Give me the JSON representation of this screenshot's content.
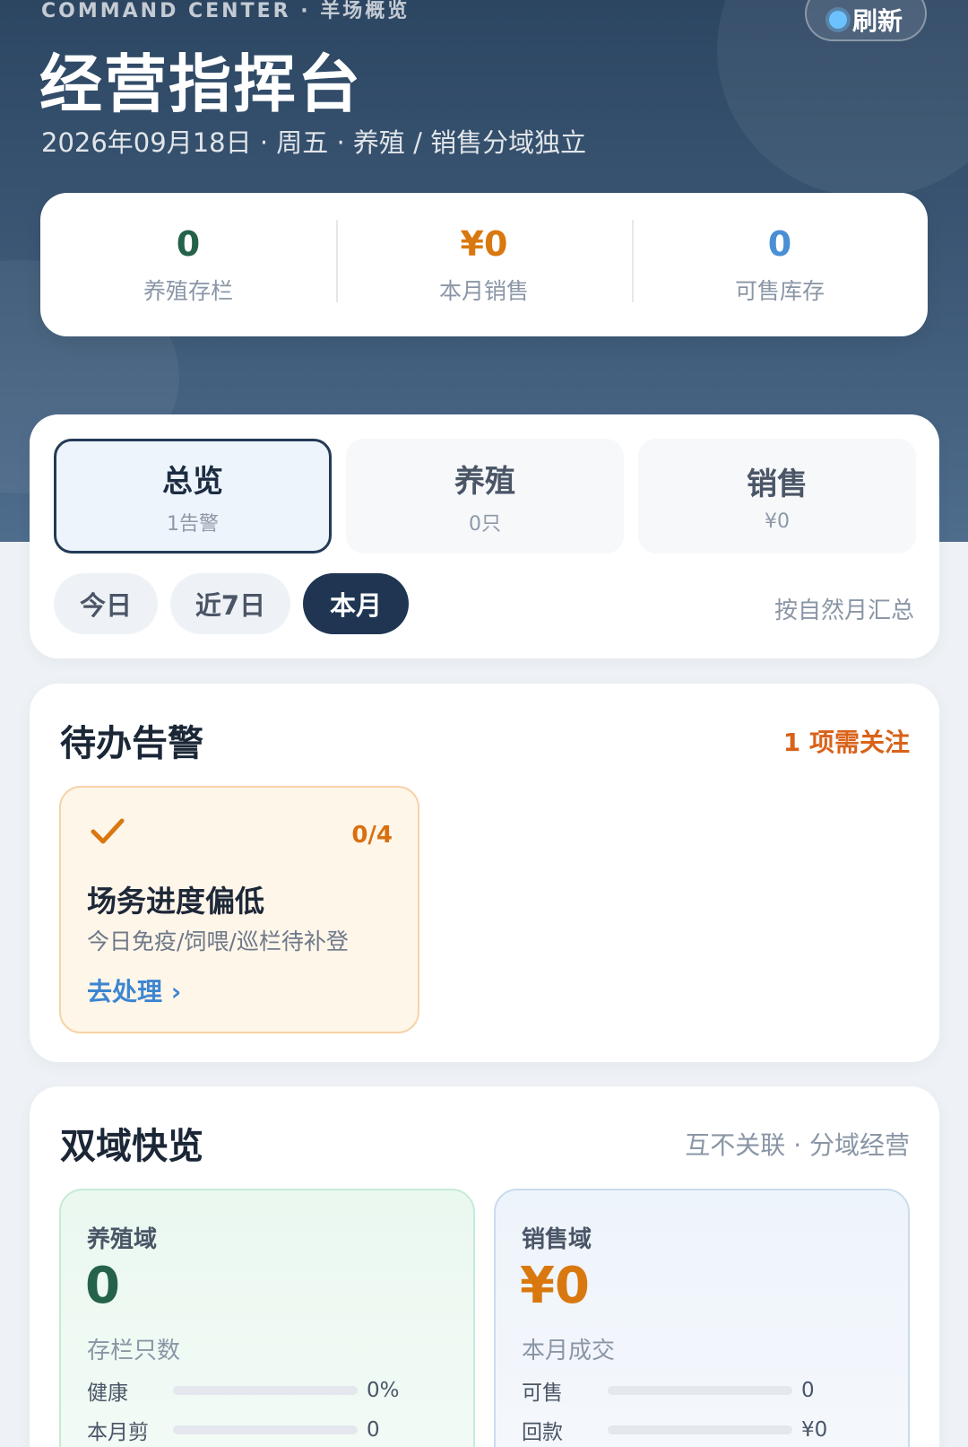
{
  "header": {
    "eyebrow": "COMMAND CENTER · 羊场概览",
    "title": "经营指挥台",
    "subtitle": "2026年09月18日 · 周五 · 养殖 / 销售分域独立",
    "refresh_label": "刷新"
  },
  "summary": [
    {
      "value": "0",
      "label": "养殖存栏"
    },
    {
      "value": "¥0",
      "label": "本月销售"
    },
    {
      "value": "0",
      "label": "可售库存"
    }
  ],
  "segments": [
    {
      "label": "总览",
      "sub": "1告警",
      "active": true
    },
    {
      "label": "养殖",
      "sub": "0只",
      "active": false
    },
    {
      "label": "销售",
      "sub": "¥0",
      "active": false
    }
  ],
  "ranges": [
    {
      "label": "今日",
      "active": false
    },
    {
      "label": "近7日",
      "active": false
    },
    {
      "label": "本月",
      "active": true
    }
  ],
  "range_note": "按自然月汇总",
  "alerts": {
    "title": "待办告警",
    "note": "1 项需关注",
    "items": [
      {
        "count": "0/4",
        "title": "场务进度偏低",
        "desc": "今日免疫/饲喂/巡栏待补登",
        "link": "去处理 ›",
        "icon": "check-icon"
      }
    ]
  },
  "domains": {
    "title": "双域快览",
    "note": "互不关联 · 分域经营",
    "farm": {
      "label": "养殖域",
      "value": "0",
      "sub": "存栏只数",
      "bars": [
        {
          "label": "健康",
          "value": "0%",
          "fraction": 0
        },
        {
          "label": "本月剪",
          "value": "0",
          "fraction": 0
        }
      ]
    },
    "sales": {
      "label": "销售域",
      "value": "¥0",
      "sub": "本月成交",
      "bars": [
        {
          "label": "可售",
          "value": "0",
          "fraction": 0
        },
        {
          "label": "回款",
          "value": "¥0",
          "fraction": 0
        }
      ]
    }
  },
  "colors": {
    "green": "#25624a",
    "orange": "#d9780f",
    "blue": "#4a8fd4",
    "navy": "#1f3552",
    "warn": "#d9621a"
  }
}
